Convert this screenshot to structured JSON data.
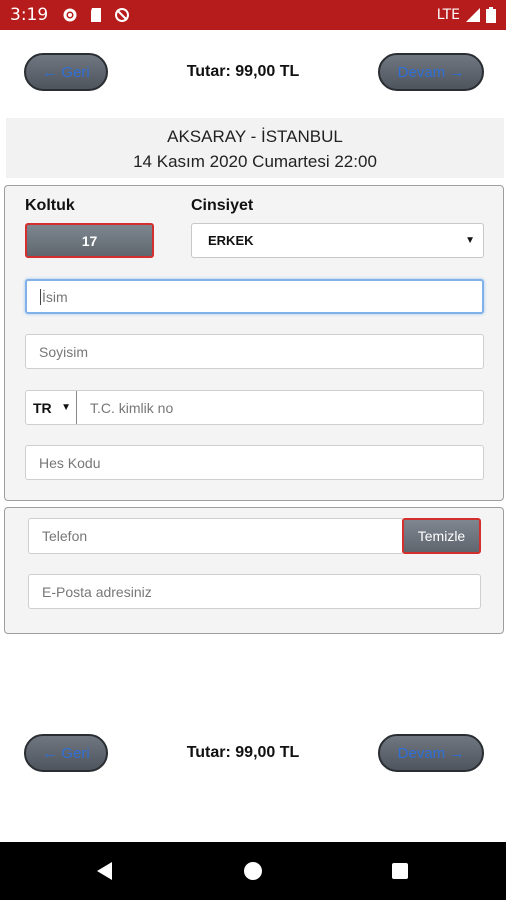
{
  "status_bar": {
    "time": "3:19",
    "icons": [
      "gear-icon",
      "sd-card-icon",
      "no-sync-icon"
    ],
    "network": "LTE"
  },
  "nav": {
    "back_label": "← Geri",
    "next_label": "Devam →",
    "total": "Tutar: 99,00 TL"
  },
  "route": {
    "title": "AKSARAY - İSTANBUL",
    "datetime": "14 Kasım 2020 Cumartesi 22:00"
  },
  "passenger": {
    "seat_label": "Koltuk",
    "seat_value": "17",
    "gender_label": "Cinsiyet",
    "gender_value": "ERKEK",
    "name_placeholder": "İsim",
    "surname_placeholder": "Soyisim",
    "country_code": "TR",
    "id_placeholder": "T.C. kimlik no",
    "hes_placeholder": "Hes Kodu"
  },
  "contact": {
    "phone_placeholder": "Telefon",
    "clear_label": "Temizle",
    "email_placeholder": "E-Posta adresiniz"
  },
  "colors": {
    "status_bar": "#b71c1c",
    "button_text": "#2f6fd6",
    "accent_border": "#d32f2f"
  }
}
